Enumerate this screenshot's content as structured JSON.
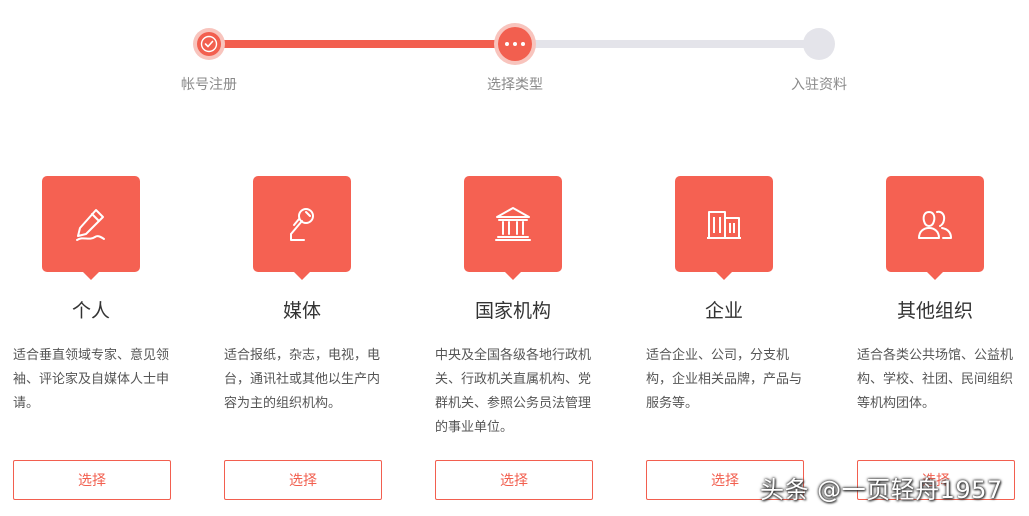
{
  "steps": [
    {
      "label": "帐号注册",
      "status": "done",
      "icon": "check-icon"
    },
    {
      "label": "选择类型",
      "status": "current",
      "icon": "ellipsis-icon"
    },
    {
      "label": "入驻资料",
      "status": "pending",
      "icon": ""
    }
  ],
  "progress": {
    "completed_fraction": 0.5
  },
  "cards": [
    {
      "icon": "pencil-icon",
      "title": "个人",
      "desc": "适合垂直领域专家、意见领袖、评论家及自媒体人士申请。",
      "button": "选择"
    },
    {
      "icon": "microphone-icon",
      "title": "媒体",
      "desc": "适合报纸，杂志，电视，电台，通讯社或其他以生产内容为主的组织机构。",
      "button": "选择"
    },
    {
      "icon": "government-building-icon",
      "title": "国家机构",
      "desc": "中央及全国各级各地行政机关、行政机关直属机构、党群机关、参照公务员法管理的事业单位。",
      "button": "选择"
    },
    {
      "icon": "office-building-icon",
      "title": "企业",
      "desc": "适合企业、公司，分支机构，企业相关品牌，产品与服务等。",
      "button": "选择"
    },
    {
      "icon": "group-users-icon",
      "title": "其他组织",
      "desc": "适合各类公共场馆、公益机构、学校、社团、民间组织等机构团体。",
      "button": "选择"
    }
  ],
  "colors": {
    "accent": "#f25f4f",
    "icon_bg": "#f56152",
    "track_inactive": "#e4e4ea"
  },
  "watermark": "头条 @一页轻舟1957"
}
